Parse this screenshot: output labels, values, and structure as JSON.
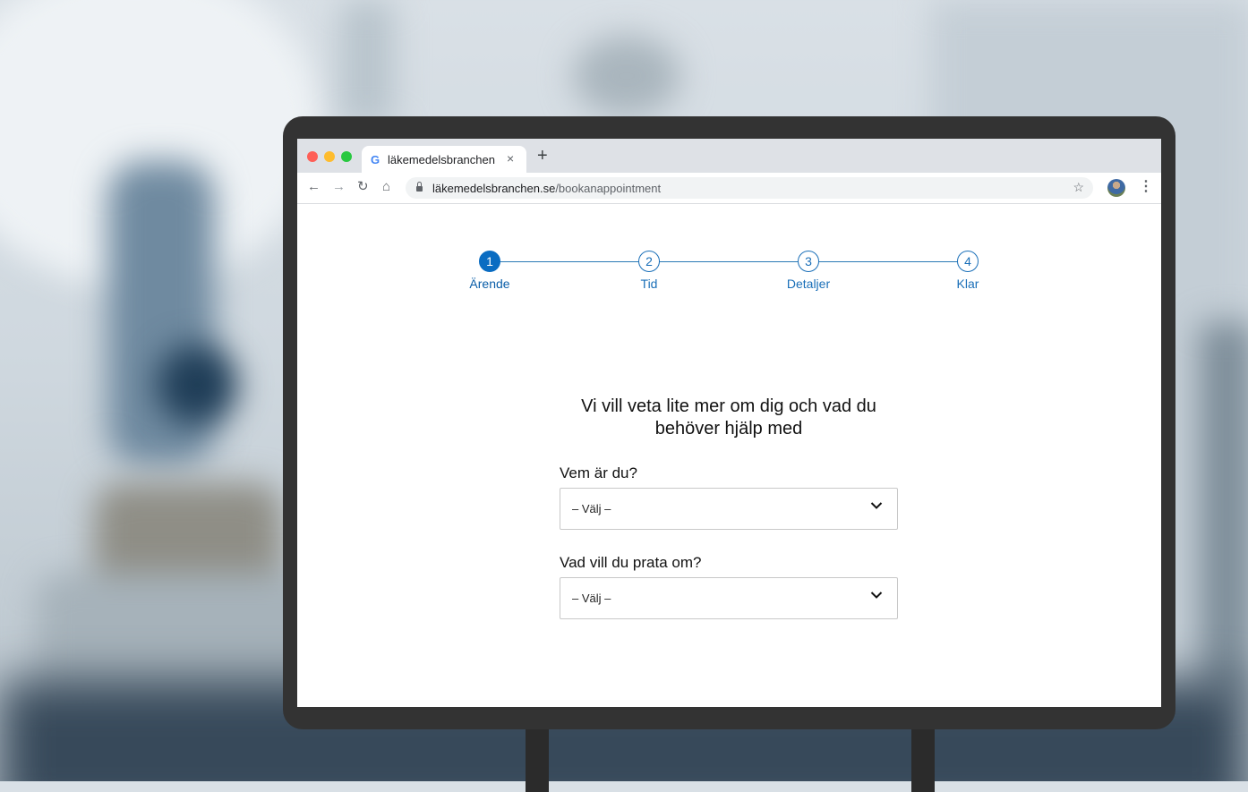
{
  "browser": {
    "tab_title": "läkemedelsbranchen",
    "tab_favicon": "google-g-icon",
    "tab_close": "×",
    "new_tab": "+",
    "url_domain": "läkemedelsbranchen.se",
    "url_path": "/bookanappointment",
    "icons": [
      "back-icon",
      "forward-icon",
      "reload-icon",
      "home-icon",
      "lock-icon",
      "star-icon",
      "avatar",
      "menu-icon"
    ]
  },
  "stepper": {
    "steps": [
      {
        "number": "1",
        "label": "Ärende",
        "active": true
      },
      {
        "number": "2",
        "label": "Tid",
        "active": false
      },
      {
        "number": "3",
        "label": "Detaljer",
        "active": false
      },
      {
        "number": "4",
        "label": "Klar",
        "active": false
      }
    ]
  },
  "form": {
    "heading_line1": "Vi vill veta lite mer om dig och vad du",
    "heading_line2": "behöver hjälp med",
    "field1_label": "Vem är du?",
    "field1_value": "– Välj –",
    "field2_label": "Vad vill du prata om?",
    "field2_value": "– Välj –"
  },
  "colors": {
    "accent": "#0a6cc2",
    "chrome_tabbar": "#dee1e6",
    "monitor_frame": "#333333"
  }
}
